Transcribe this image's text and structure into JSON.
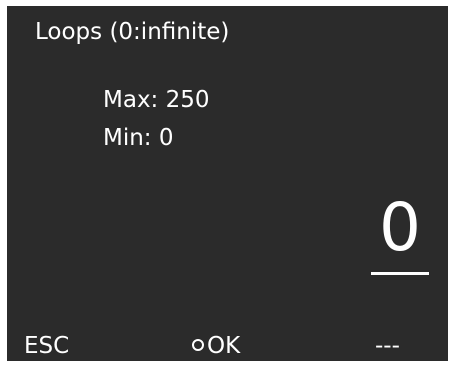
{
  "screen": {
    "title": "Loops (0:infinite)",
    "max_label": "Max: 250",
    "min_label": "Min: 0",
    "value": "0"
  },
  "softkeys": {
    "left": "ESC",
    "center": "OK",
    "right": "---"
  },
  "colors": {
    "background": "#2b2b2b",
    "text": "#ffffff"
  }
}
